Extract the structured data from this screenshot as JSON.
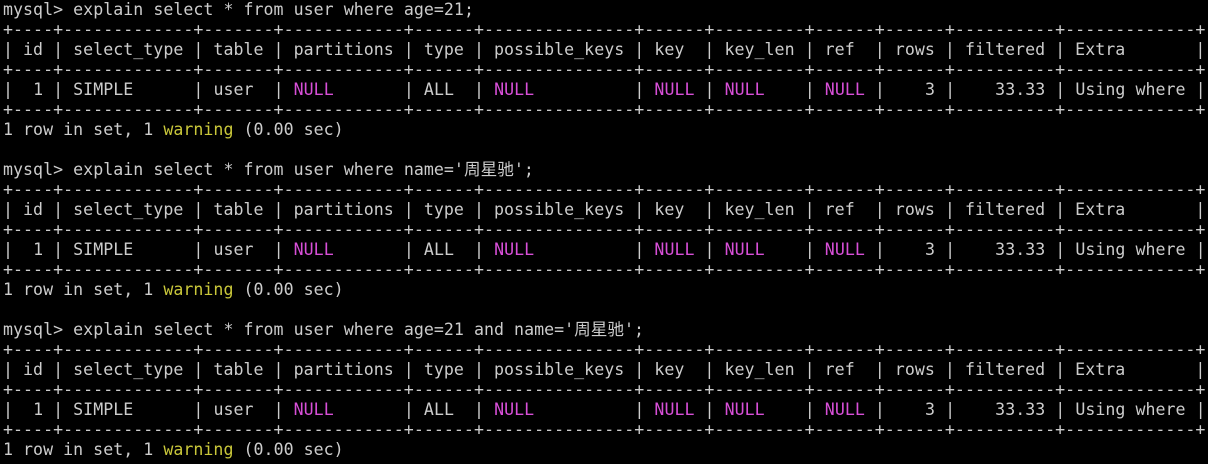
{
  "colors": {
    "background": "#000000",
    "text": "#cccccc",
    "null_highlight": "#d74fd7",
    "warning_highlight": "#c9c73a"
  },
  "queries": [
    {
      "prompt": "mysql> ",
      "command": "explain select * from user where age=21;",
      "border": "+----+-------------+-------+------------+------+---------------+------+---------+------+------+----------+-------------+",
      "header": "| id | select_type | table | partitions | type | possible_keys | key  | key_len | ref  | rows | filtered | Extra       |",
      "row": {
        "id": "1",
        "select_type": "SIMPLE",
        "table": "user",
        "partitions": "NULL",
        "type": "ALL",
        "possible_keys": "NULL",
        "key": "NULL",
        "key_len": "NULL",
        "ref": "NULL",
        "rows": "3",
        "filtered": "33.33",
        "extra": "Using where"
      },
      "result": {
        "prefix": "1 row in set, 1 ",
        "warning": "warning",
        "suffix": " (0.00 sec)"
      }
    },
    {
      "prompt": "mysql> ",
      "command": "explain select * from user where name='周星驰';",
      "border": "+----+-------------+-------+------------+------+---------------+------+---------+------+------+----------+-------------+",
      "header": "| id | select_type | table | partitions | type | possible_keys | key  | key_len | ref  | rows | filtered | Extra       |",
      "row": {
        "id": "1",
        "select_type": "SIMPLE",
        "table": "user",
        "partitions": "NULL",
        "type": "ALL",
        "possible_keys": "NULL",
        "key": "NULL",
        "key_len": "NULL",
        "ref": "NULL",
        "rows": "3",
        "filtered": "33.33",
        "extra": "Using where"
      },
      "result": {
        "prefix": "1 row in set, 1 ",
        "warning": "warning",
        "suffix": " (0.00 sec)"
      }
    },
    {
      "prompt": "mysql> ",
      "command": "explain select * from user where age=21 and name='周星驰';",
      "border": "+----+-------------+-------+------------+------+---------------+------+---------+------+------+----------+-------------+",
      "header": "| id | select_type | table | partitions | type | possible_keys | key  | key_len | ref  | rows | filtered | Extra       |",
      "row": {
        "id": "1",
        "select_type": "SIMPLE",
        "table": "user",
        "partitions": "NULL",
        "type": "ALL",
        "possible_keys": "NULL",
        "key": "NULL",
        "key_len": "NULL",
        "ref": "NULL",
        "rows": "3",
        "filtered": "33.33",
        "extra": "Using where"
      },
      "result": {
        "prefix": "1 row in set, 1 ",
        "warning": "warning",
        "suffix": " (0.00 sec)"
      }
    }
  ]
}
